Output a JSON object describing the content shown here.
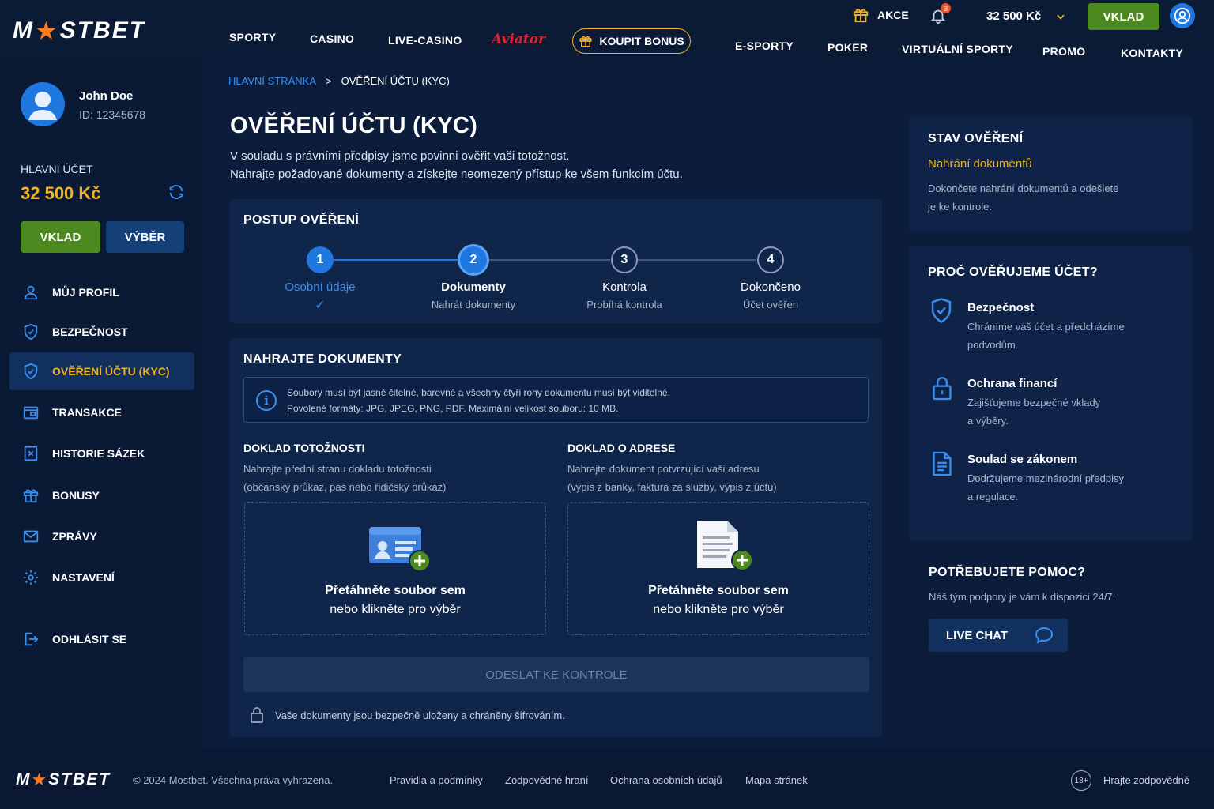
{
  "header": {
    "logo_left": "M",
    "logo_right": "STBET",
    "nav": {
      "sporty": "SPORTY",
      "casino": "CASINO",
      "live_casino": "LIVE-CASINO",
      "aviator": "Aviator",
      "bonus": "KOUPIT BONUS",
      "esporty": "E-SPORTY",
      "poker": "POKER",
      "virtual": "VIRTUÁLNÍ SPORTY",
      "promo": "PROMO",
      "kontakty": "KONTAKTY"
    },
    "akce": "AKCE",
    "notification_count": "3",
    "balance": "32 500 Kč",
    "deposit": "VKLAD"
  },
  "sidebar": {
    "user_name": "John Doe",
    "user_id": "ID: 12345678",
    "account_label": "HLAVNÍ ÚČET",
    "balance": "32 500 Kč",
    "deposit": "VKLAD",
    "withdraw": "VÝBĚR",
    "items": [
      {
        "label": "MŮJ PROFIL"
      },
      {
        "label": "BEZPEČNOST"
      },
      {
        "label": "OVĚŘENÍ ÚČTU (KYC)"
      },
      {
        "label": "TRANSAKCE"
      },
      {
        "label": "HISTORIE SÁZEK"
      },
      {
        "label": "BONUSY"
      },
      {
        "label": "ZPRÁVY"
      },
      {
        "label": "NASTAVENÍ"
      }
    ],
    "logout": "ODHLÁSIT SE"
  },
  "breadcrumb": {
    "home": "HLAVNÍ STRÁNKA",
    "separator": ">",
    "current": "OVĚŘENÍ ÚČTU (KYC)"
  },
  "main": {
    "title": "OVĚŘENÍ ÚČTU (KYC)",
    "intro_1": "V souladu s právními předpisy jsme povinni ověřit vaši totožnost.",
    "intro_2": "Nahrajte požadované dokumenty a získejte neomezený přístup ke všem funkcím účtu.",
    "progress_title": "POSTUP OVĚŘENÍ",
    "steps": [
      {
        "num": "1",
        "title": "Osobní údaje",
        "sub": "✓"
      },
      {
        "num": "2",
        "title": "Dokumenty",
        "sub": "Nahrát dokumenty"
      },
      {
        "num": "3",
        "title": "Kontrola",
        "sub": "Probíhá kontrola"
      },
      {
        "num": "4",
        "title": "Dokončeno",
        "sub": "Účet ověřen"
      }
    ],
    "upload_title": "NAHRAJTE DOKUMENTY",
    "info_1": "Soubory musí být jasně čitelné, barevné a všechny čtyři rohy dokumentu musí být viditelné.",
    "info_2": "Povolené formáty: JPG, JPEG, PNG, PDF. Maximální velikost souboru: 10 MB.",
    "id_doc": {
      "title": "DOKLAD TOTOŽNOSTI",
      "desc_1": "Nahrajte přední stranu dokladu totožnosti",
      "desc_2": "(občanský průkaz, pas nebo řidičský průkaz)",
      "drop_1": "Přetáhněte soubor sem",
      "drop_2": "nebo klikněte pro výběr"
    },
    "addr_doc": {
      "title": "DOKLAD O ADRESE",
      "desc_1": "Nahrajte dokument potvrzující vaši adresu",
      "desc_2": "(výpis z banky, faktura za služby, výpis z účtu)",
      "drop_1": "Přetáhněte soubor sem",
      "drop_2": "nebo klikněte pro výběr"
    },
    "submit": "ODESLAT KE KONTROLE",
    "secure_note": "Vaše dokumenty jsou bezpečně uloženy a chráněny šifrováním."
  },
  "right": {
    "status_title": "STAV OVĚŘENÍ",
    "status_value": "Nahrání dokumentů",
    "status_desc_1": "Dokončete nahrání dokumentů a odešlete",
    "status_desc_2": "je ke kontrole.",
    "why_title": "PROČ OVĚŘUJEME ÚČET?",
    "reasons": [
      {
        "title": "Bezpečnost",
        "desc_1": "Chráníme váš účet a předcházíme",
        "desc_2": "podvodům."
      },
      {
        "title": "Ochrana financí",
        "desc_1": "Zajišťujeme bezpečné vklady",
        "desc_2": "a výběry."
      },
      {
        "title": "Soulad se zákonem",
        "desc_1": "Dodržujeme mezinárodní předpisy",
        "desc_2": "a regulace."
      }
    ],
    "help_title": "POTŘEBUJETE POMOC?",
    "help_desc": "Náš tým podpory je vám k dispozici 24/7.",
    "live_chat": "LIVE CHAT"
  },
  "footer": {
    "logo_left": "M",
    "logo_right": "STBET",
    "copyright": "© 2024 Mostbet. Všechna práva vyhrazena.",
    "links": [
      "Pravidla a podmínky",
      "Zodpovědné hraní",
      "Ochrana osobních údajů",
      "Mapa stránek"
    ],
    "age": "18+",
    "responsible": "Hrajte zodpovědně"
  },
  "colors": {
    "accent_yellow": "#f0b323",
    "green": "#4c8a1f",
    "blue_step": "#1e78e0",
    "background": "#0c1d3b"
  }
}
